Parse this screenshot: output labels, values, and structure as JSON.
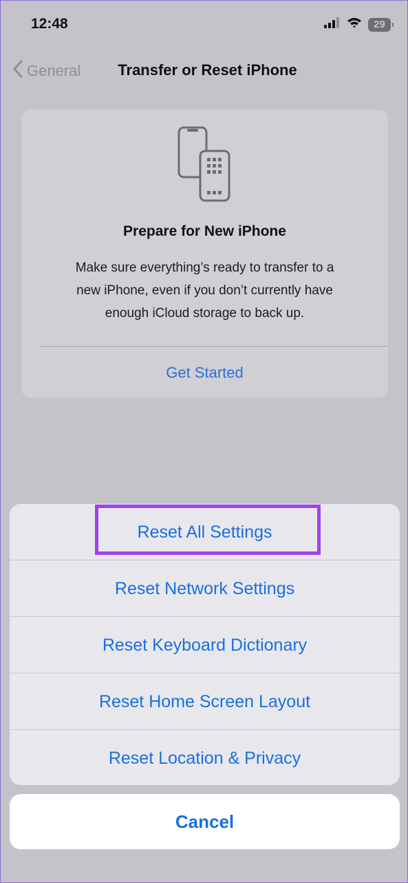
{
  "status_bar": {
    "time": "12:48",
    "battery": "29"
  },
  "nav": {
    "back_label": "General",
    "title": "Transfer or Reset iPhone"
  },
  "prepare_card": {
    "title": "Prepare for New iPhone",
    "body_lines": [
      "Make sure everything’s ready to transfer to a",
      "new iPhone, even if you don’t currently have",
      "enough iCloud storage to back up."
    ],
    "action": "Get Started"
  },
  "reset_sheet": {
    "items": [
      {
        "label": "Reset All Settings"
      },
      {
        "label": "Reset Network Settings"
      },
      {
        "label": "Reset Keyboard Dictionary"
      },
      {
        "label": "Reset Home Screen Layout"
      },
      {
        "label": "Reset Location & Privacy"
      }
    ],
    "cancel_label": "Cancel"
  },
  "colors": {
    "accent": "#1a6fe0",
    "highlight": "#a040f0",
    "background": "#c4c3c9"
  }
}
